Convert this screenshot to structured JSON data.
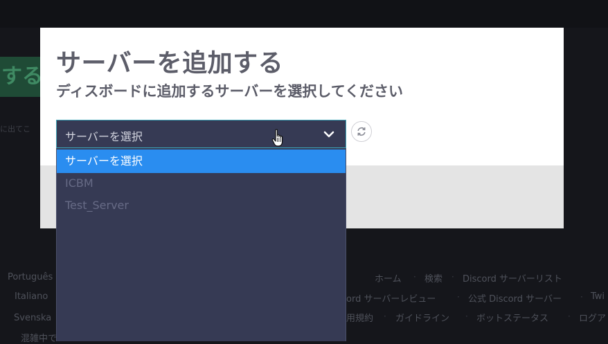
{
  "background": {
    "hero_button_label": "する",
    "hint_text": "に出てこ",
    "footer": {
      "languages": [
        "Português",
        "Italiano",
        "Svenska"
      ],
      "status_text": "混雑中で",
      "row1": [
        "ホーム",
        "検索",
        "Discord サーバーリスト"
      ],
      "row2": [
        "ord サーバーレビュー",
        "公式 Discord サーバー",
        "Twi"
      ],
      "row3": [
        "用規約",
        "ガイドライン",
        "ボットステータス",
        "ログア"
      ]
    }
  },
  "modal": {
    "title": "サーバーを追加する",
    "subtitle": "ディスボードに追加するサーバーを選択してください",
    "select": {
      "current_value": "サーバーを選択",
      "icon": "chevron-down-icon"
    },
    "refresh_icon": "refresh-icon"
  },
  "dropdown": {
    "options": [
      {
        "label": "サーバーを選択",
        "selected": true
      },
      {
        "label": "ICBM",
        "selected": false
      },
      {
        "label": "Test_Server",
        "selected": false
      }
    ]
  },
  "colors": {
    "select_bg": "#363a54",
    "select_border": "#3ea5b8",
    "option_highlight": "#2a8df0",
    "title_text": "#5c5d69"
  },
  "cursor_icon": "hand-pointer-icon"
}
